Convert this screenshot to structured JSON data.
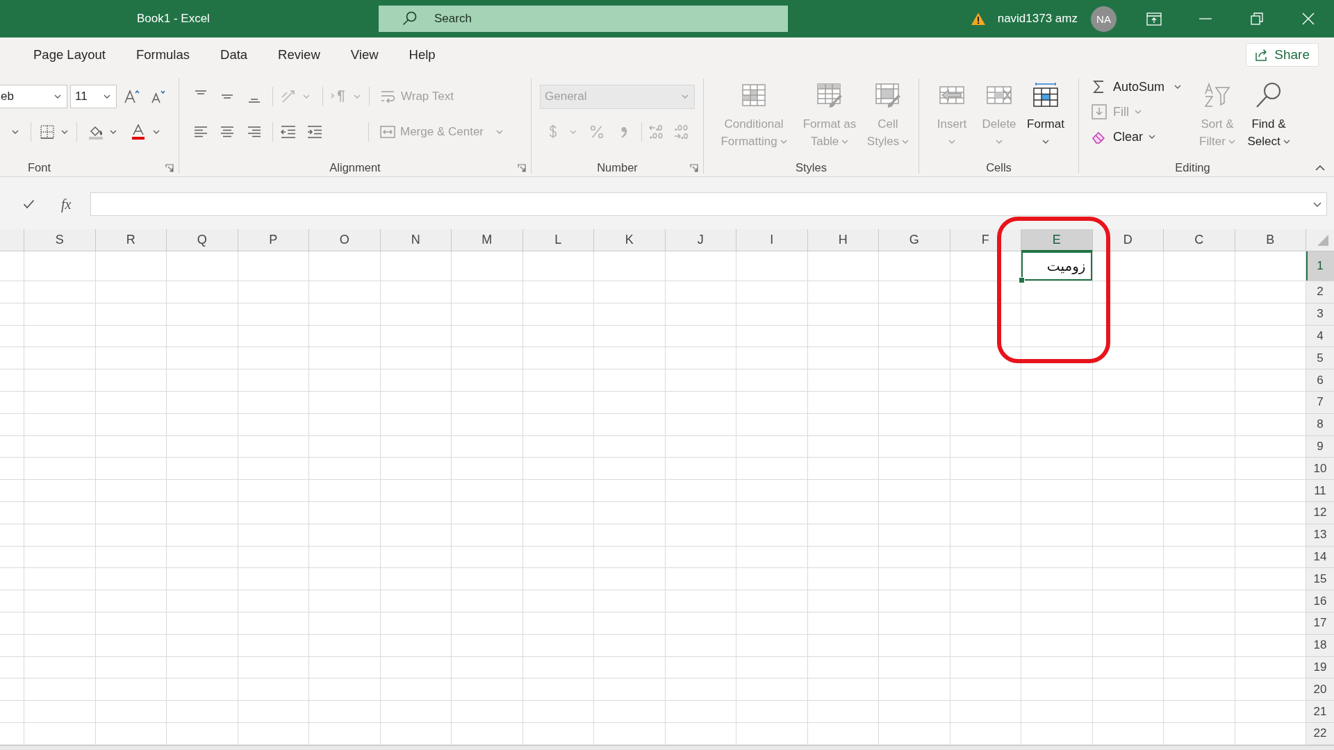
{
  "title_bar": {
    "title": "Book1 - Excel",
    "search": {
      "placeholder": "Search"
    },
    "account": {
      "name": "navid1373 amz",
      "initials": "NA"
    }
  },
  "ribbon_tabs": [
    {
      "label": "Page Layout",
      "selected": false
    },
    {
      "label": "Formulas",
      "selected": false
    },
    {
      "label": "Data",
      "selected": false
    },
    {
      "label": "Review",
      "selected": false
    },
    {
      "label": "View",
      "selected": false
    },
    {
      "label": "Help",
      "selected": false
    }
  ],
  "share_button": {
    "label": "Share"
  },
  "ribbon": {
    "font": {
      "label": "Font",
      "font_name": "eb",
      "font_size": "11"
    },
    "alignment": {
      "label": "Alignment",
      "wrap_text": {
        "label": "Wrap Text",
        "disabled": true
      },
      "merge": {
        "label": "Merge & Center",
        "disabled": true
      }
    },
    "number": {
      "label": "Number",
      "format": {
        "value": "General",
        "disabled": true
      }
    },
    "styles": {
      "label": "Styles",
      "buttons": [
        {
          "lines": [
            "Conditional",
            "Formatting"
          ],
          "disabled": true
        },
        {
          "lines": [
            "Format as",
            "Table"
          ],
          "disabled": true
        },
        {
          "lines": [
            "Cell",
            "Styles"
          ],
          "disabled": true
        }
      ]
    },
    "cells": {
      "label": "Cells",
      "buttons": [
        {
          "lines": [
            "Insert"
          ],
          "disabled": true
        },
        {
          "lines": [
            "Delete"
          ],
          "disabled": true
        },
        {
          "lines": [
            "Format"
          ],
          "disabled": false
        }
      ]
    },
    "editing": {
      "label": "Editing",
      "small_buttons": [
        {
          "label": "AutoSum",
          "disabled": false
        },
        {
          "label": "Fill",
          "disabled": true
        },
        {
          "label": "Clear",
          "disabled": false
        }
      ],
      "buttons": [
        {
          "lines": [
            "Sort &",
            "Filter"
          ],
          "disabled": true
        },
        {
          "lines": [
            "Find &",
            "Select"
          ],
          "disabled": false
        }
      ]
    }
  },
  "formula_bar": {
    "function_label": "fx"
  },
  "sheet": {
    "columns": [
      {
        "label": "S",
        "selected": false
      },
      {
        "label": "R",
        "selected": false
      },
      {
        "label": "Q",
        "selected": false
      },
      {
        "label": "P",
        "selected": false
      },
      {
        "label": "O",
        "selected": false
      },
      {
        "label": "N",
        "selected": false
      },
      {
        "label": "M",
        "selected": false
      },
      {
        "label": "L",
        "selected": false
      },
      {
        "label": "K",
        "selected": false
      },
      {
        "label": "J",
        "selected": false
      },
      {
        "label": "I",
        "selected": false
      },
      {
        "label": "H",
        "selected": false
      },
      {
        "label": "G",
        "selected": false
      },
      {
        "label": "F",
        "selected": false
      },
      {
        "label": "E",
        "selected": true
      },
      {
        "label": "D",
        "selected": false
      },
      {
        "label": "C",
        "selected": false
      },
      {
        "label": "B",
        "selected": false
      }
    ],
    "rows": [
      {
        "label": "1",
        "selected": true
      },
      {
        "label": "2",
        "selected": false
      },
      {
        "label": "3",
        "selected": false
      },
      {
        "label": "4",
        "selected": false
      },
      {
        "label": "5",
        "selected": false
      },
      {
        "label": "6",
        "selected": false
      },
      {
        "label": "7",
        "selected": false
      },
      {
        "label": "8",
        "selected": false
      },
      {
        "label": "9",
        "selected": false
      },
      {
        "label": "10",
        "selected": false
      },
      {
        "label": "11",
        "selected": false
      },
      {
        "label": "12",
        "selected": false
      },
      {
        "label": "13",
        "selected": false
      },
      {
        "label": "14",
        "selected": false
      },
      {
        "label": "15",
        "selected": false
      },
      {
        "label": "16",
        "selected": false
      },
      {
        "label": "17",
        "selected": false
      },
      {
        "label": "18",
        "selected": false
      },
      {
        "label": "19",
        "selected": false
      },
      {
        "label": "20",
        "selected": false
      },
      {
        "label": "21",
        "selected": false
      },
      {
        "label": "22",
        "selected": false
      }
    ],
    "active_cell": {
      "value": "زومیت"
    },
    "annotation": {
      "kind": "rounded-outline"
    }
  }
}
